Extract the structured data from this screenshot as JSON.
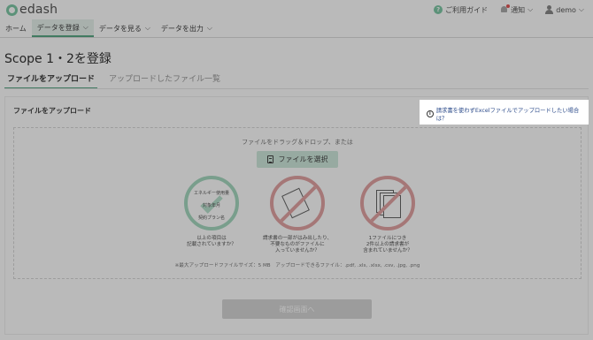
{
  "header": {
    "logo_text": "edash",
    "guide_label": "ご利用ガイド",
    "notifications_label": "通知",
    "user_label": "demo"
  },
  "nav": {
    "items": [
      {
        "label": "ホーム",
        "active": false,
        "has_dropdown": false
      },
      {
        "label": "データを登録",
        "active": true,
        "has_dropdown": true
      },
      {
        "label": "データを見る",
        "active": false,
        "has_dropdown": true
      },
      {
        "label": "データを出力",
        "active": false,
        "has_dropdown": true
      }
    ]
  },
  "page": {
    "title": "Scope 1・2を登録",
    "tabs": [
      {
        "label": "ファイルをアップロード",
        "active": true
      },
      {
        "label": "アップロードしたファイル一覧",
        "active": false
      }
    ]
  },
  "upload_card": {
    "title": "ファイルをアップロード",
    "help_link": "請求書を使わずExcelファイルでアップロードしたい場合は？",
    "dropzone_text": "ファイルをドラッグ＆ドロップ、または",
    "select_button": "ファイルを選択",
    "tips": [
      {
        "type": "ok",
        "lines": [
          "エネルギー使用量",
          "対象年月",
          "契約プラン名"
        ],
        "caption": [
          "以上の項目は",
          "記載されていますか？"
        ]
      },
      {
        "type": "ng",
        "caption": [
          "請求書の一部がはみ出したり、",
          "不要なものがファイルに",
          "入っていませんか？"
        ]
      },
      {
        "type": "ng",
        "caption": [
          "1ファイルにつき",
          "2件以上の請求書が",
          "含まれていませんか？"
        ]
      }
    ],
    "note": "※最大アップロードファイルサイズ：5 MB　アップロードできるファイル：.pdf, .xls, .xlsx, .csv, .jpg, .png",
    "confirm_button": "確認画面へ"
  },
  "colors": {
    "accent": "#5aa985",
    "ok_green": "#a6d9c1",
    "ng_red": "#e3a4a4",
    "link": "#2b4a8a"
  }
}
